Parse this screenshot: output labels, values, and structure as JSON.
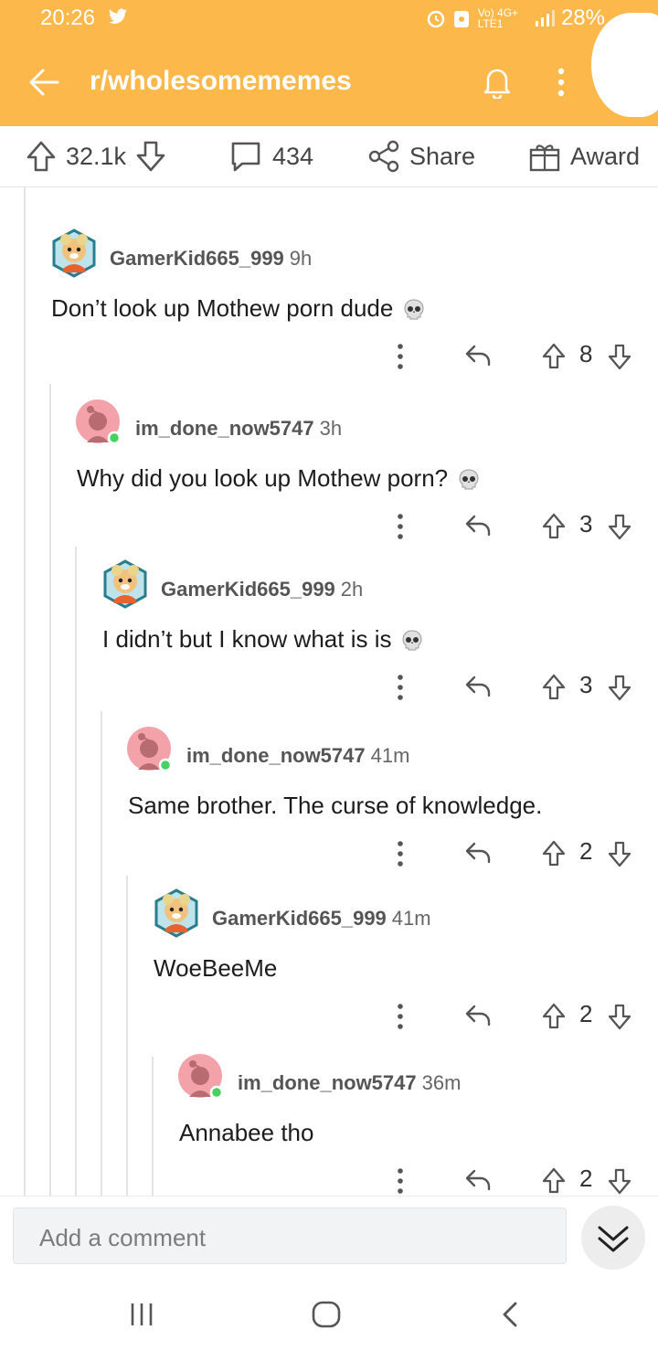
{
  "status_bar": {
    "time": "20:26",
    "battery": "28%",
    "network": "Vo) 4G+ LTE1"
  },
  "nav": {
    "subreddit": "r/wholesomememes"
  },
  "post_actions": {
    "upvotes": "32.1k",
    "comments": "434",
    "share": "Share",
    "award": "Award"
  },
  "comments": [
    {
      "user": "GamerKid665_999",
      "age": "9h",
      "text": "Don’t look up Mothew porn dude",
      "skull": true,
      "votes": "8",
      "avatar": "snoo-hex"
    },
    {
      "user": "im_done_now5747",
      "age": "3h",
      "text": "Why did you look up Mothew porn?",
      "skull": true,
      "votes": "3",
      "avatar": "snoo-pink"
    },
    {
      "user": "GamerKid665_999",
      "age": "2h",
      "text": "I didn’t but I know what is is",
      "skull": true,
      "votes": "3",
      "avatar": "snoo-hex"
    },
    {
      "user": "im_done_now5747",
      "age": "41m",
      "text": "Same brother. The curse of knowledge.",
      "skull": false,
      "votes": "2",
      "avatar": "snoo-pink"
    },
    {
      "user": "GamerKid665_999",
      "age": "41m",
      "text": "WoeBeeMe",
      "skull": false,
      "votes": "2",
      "avatar": "snoo-hex"
    },
    {
      "user": "im_done_now5747",
      "age": "36m",
      "text": "Annabee tho",
      "skull": false,
      "votes": "2",
      "avatar": "snoo-pink"
    }
  ],
  "composer": {
    "placeholder": "Add a comment"
  },
  "colors": {
    "header": "#fcb84b",
    "online": "#46d160",
    "avatar_pink": "#f4a2a9",
    "hex_border": "#2a7d8c"
  }
}
